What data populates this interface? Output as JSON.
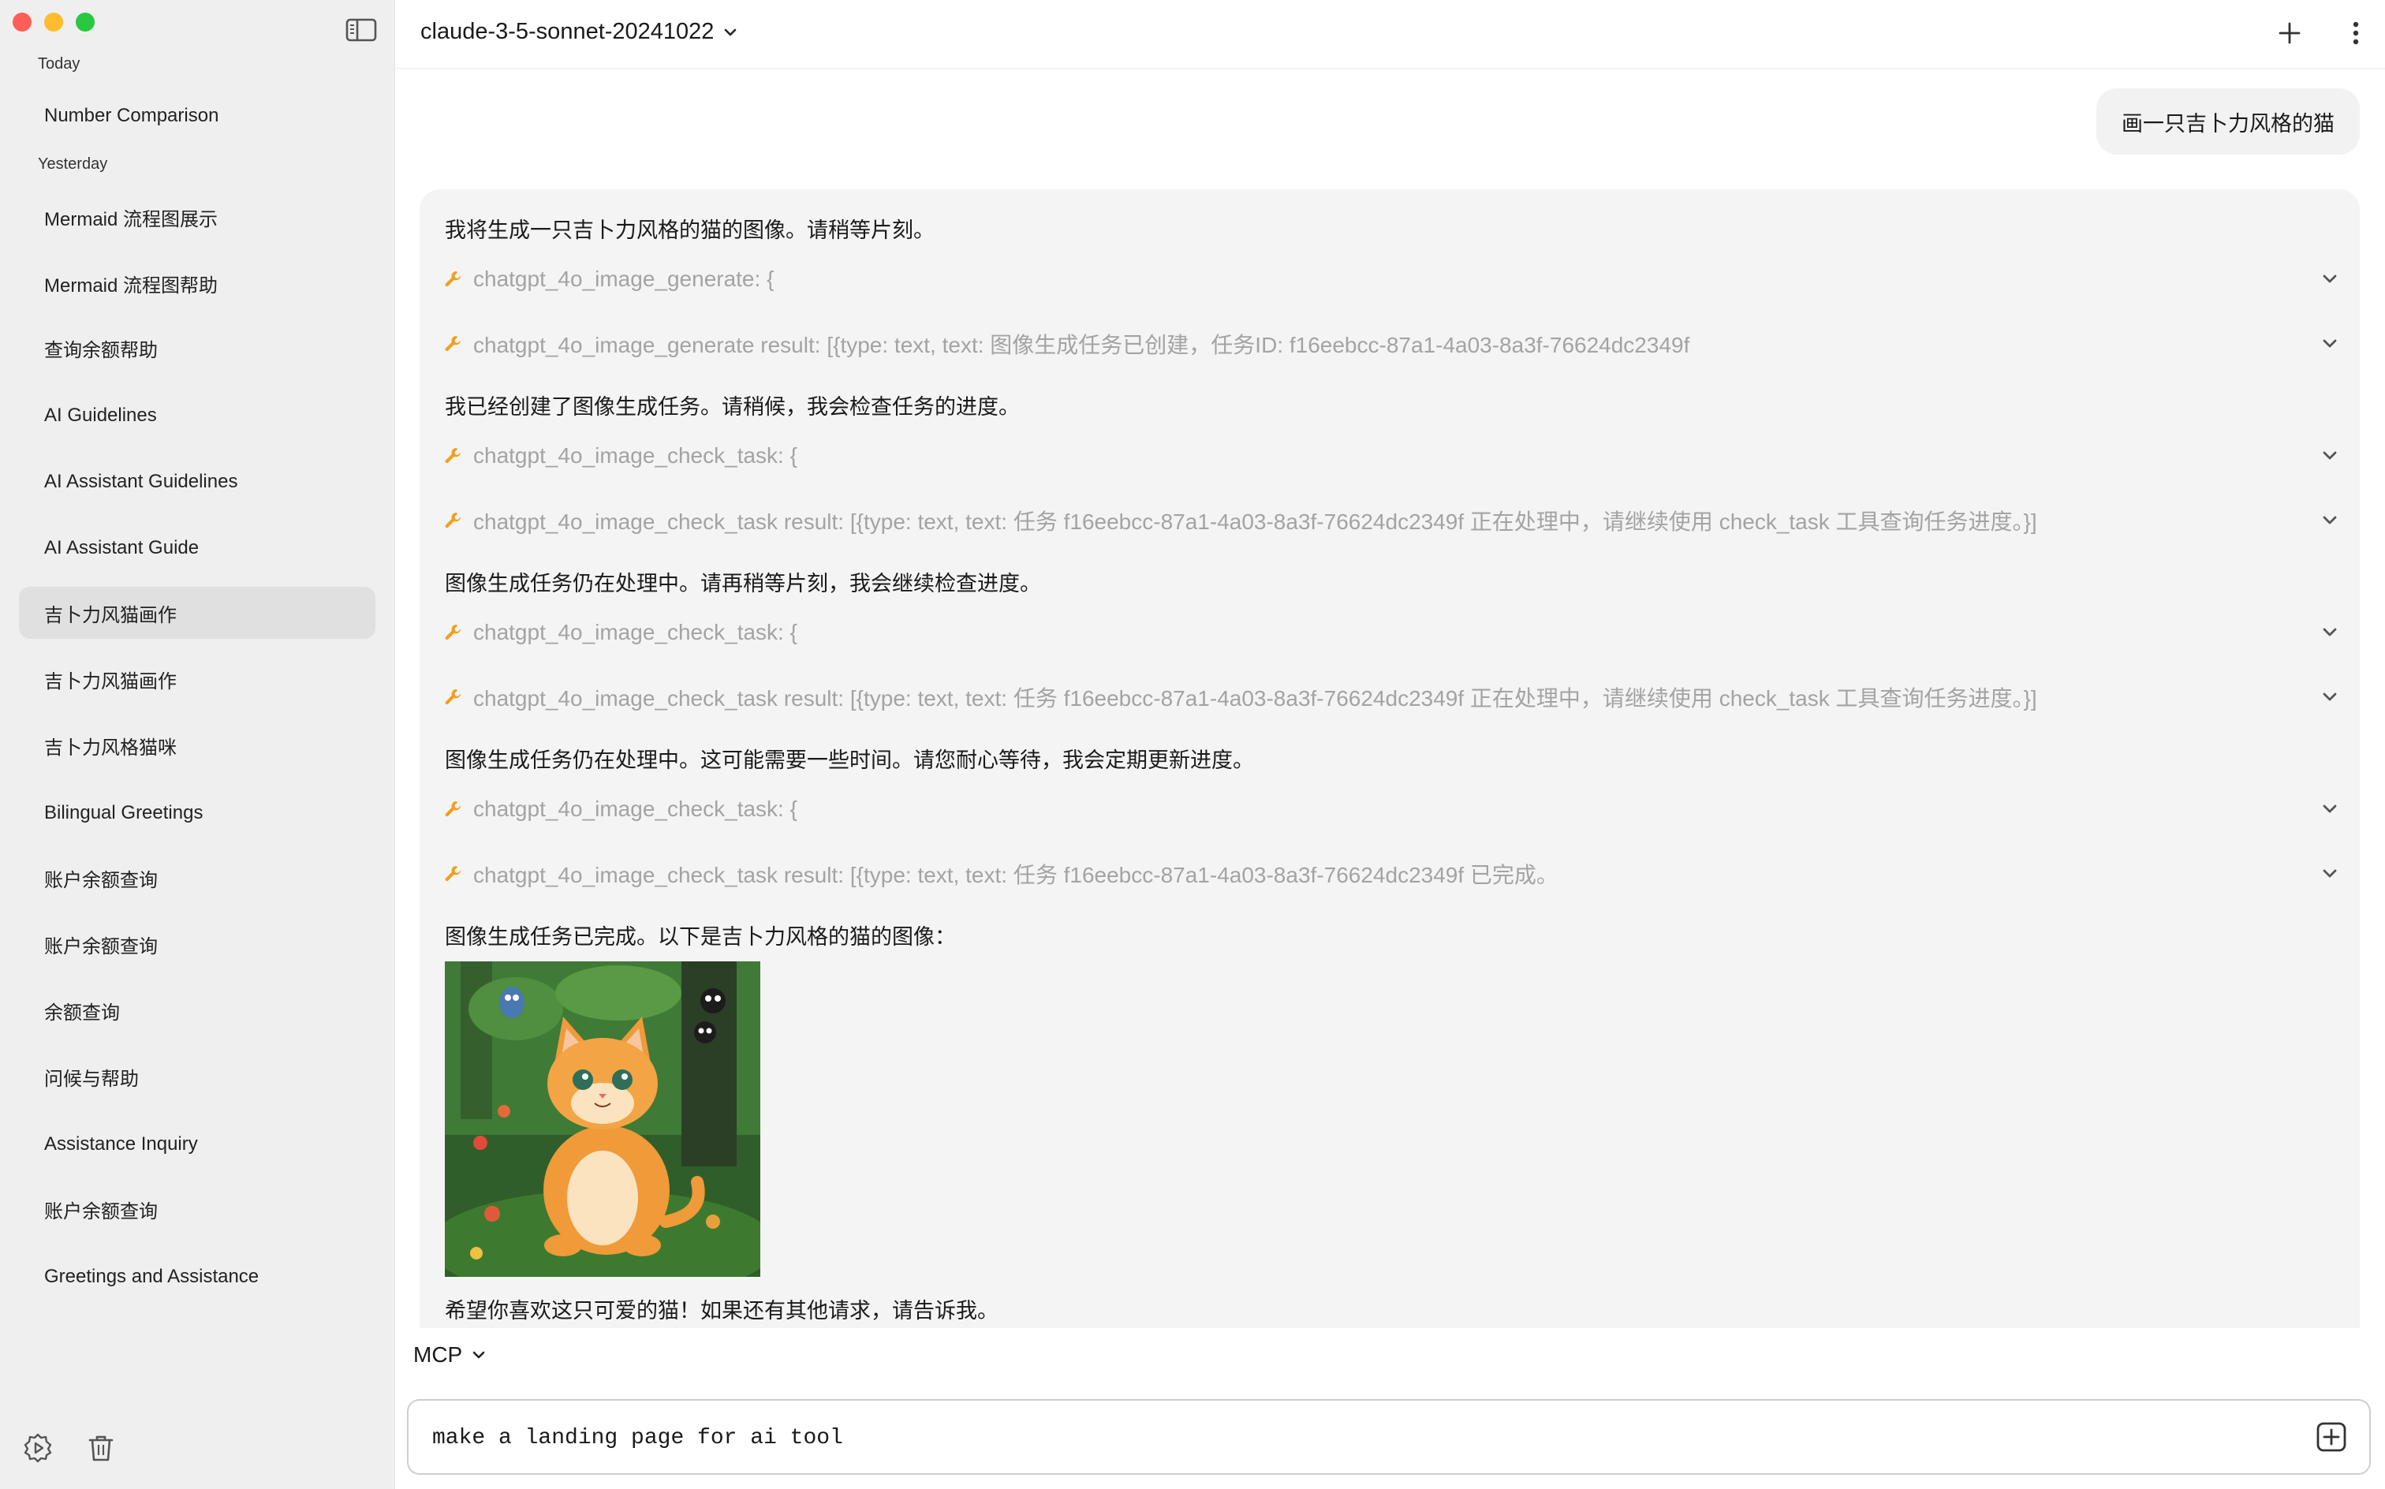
{
  "sidebar": {
    "groups": [
      {
        "label": "Today"
      },
      {
        "label": "Yesterday"
      }
    ],
    "items": [
      {
        "label": "Number Comparison"
      },
      {
        "label": "Mermaid 流程图展示"
      },
      {
        "label": "Mermaid 流程图帮助"
      },
      {
        "label": "查询余额帮助"
      },
      {
        "label": "AI Guidelines"
      },
      {
        "label": "AI Assistant Guidelines"
      },
      {
        "label": "AI Assistant Guide"
      },
      {
        "label": "吉卜力风猫画作"
      },
      {
        "label": "吉卜力风猫画作"
      },
      {
        "label": "吉卜力风格猫咪"
      },
      {
        "label": "Bilingual Greetings"
      },
      {
        "label": "账户余额查询"
      },
      {
        "label": "账户余额查询"
      },
      {
        "label": "余额查询"
      },
      {
        "label": "问候与帮助"
      },
      {
        "label": "Assistance Inquiry"
      },
      {
        "label": "账户余额查询"
      },
      {
        "label": "Greetings and Assistance"
      }
    ],
    "active_item": "吉卜力风猫画作",
    "settings_icon": "settings-icon",
    "trash_icon": "trash-icon"
  },
  "header": {
    "model": "claude-3-5-sonnet-20241022",
    "new_chat_icon": "plus-icon",
    "more_icon": "more-vertical-icon"
  },
  "chat": {
    "user_message": "画一只吉卜力风格的猫",
    "assistant": {
      "texts": [
        "我将生成一只吉卜力风格的猫的图像。请稍等片刻。",
        "我已经创建了图像生成任务。请稍候，我会检查任务的进度。",
        "图像生成任务仍在处理中。请再稍等片刻，我会继续检查进度。",
        "图像生成任务仍在处理中。这可能需要一些时间。请您耐心等待，我会定期更新进度。",
        "图像生成任务已完成。以下是吉卜力风格的猫的图像：",
        "希望你喜欢这只可爱的猫！如果还有其他请求，请告诉我。"
      ],
      "tool_calls": [
        "chatgpt_4o_image_generate: {",
        "chatgpt_4o_image_generate result: [{type: text, text: 图像生成任务已创建，任务ID: f16eebcc-87a1-4a03-8a3f-76624dc2349f",
        "chatgpt_4o_image_check_task: {",
        "chatgpt_4o_image_check_task result: [{type: text, text: 任务 f16eebcc-87a1-4a03-8a3f-76624dc2349f 正在处理中，请继续使用 check_task 工具查询任务进度。}]",
        "chatgpt_4o_image_check_task: {",
        "chatgpt_4o_image_check_task result: [{type: text, text: 任务 f16eebcc-87a1-4a03-8a3f-76624dc2349f 正在处理中，请继续使用 check_task 工具查询任务进度。}]",
        "chatgpt_4o_image_check_task: {",
        "chatgpt_4o_image_check_task result: [{type: text, text: 任务 f16eebcc-87a1-4a03-8a3f-76624dc2349f 已完成。"
      ]
    }
  },
  "composer": {
    "mode": "MCP",
    "input_value": "make a landing page for ai tool"
  },
  "colors": {
    "sidebar_bg": "#efefef",
    "bubble_bg": "#f2f2f2",
    "card_bg": "#f4f4f4",
    "tool_text": "#a3a3a3",
    "wrench": "#f0a020"
  }
}
